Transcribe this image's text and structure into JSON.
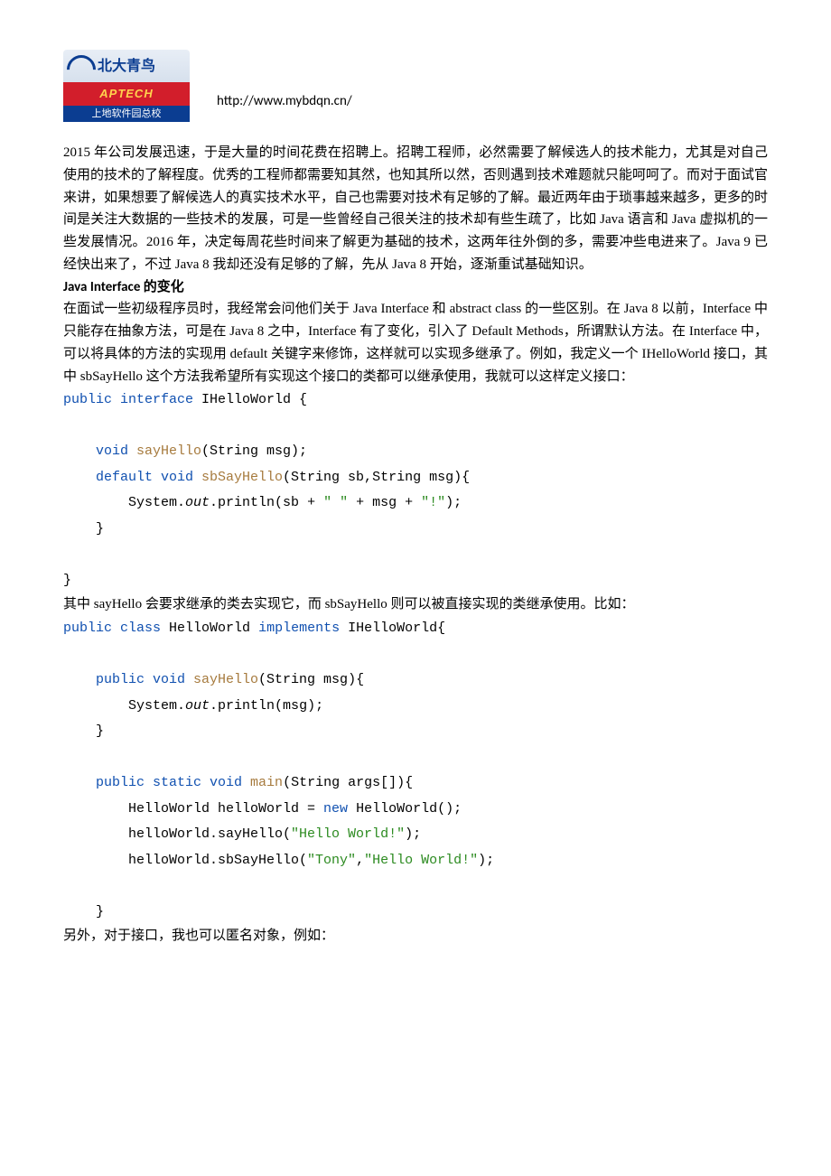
{
  "logo": {
    "brand_cn": "北大青鸟",
    "brand_en": "APTECH",
    "subtitle": "上地软件园总校"
  },
  "header_url": "http://www.mybdqn.cn/",
  "para1": "2015 年公司发展迅速，于是大量的时间花费在招聘上。招聘工程师，必然需要了解候选人的技术能力，尤其是对自己使用的技术的了解程度。优秀的工程师都需要知其然，也知其所以然，否则遇到技术难题就只能呵呵了。而对于面试官来讲，如果想要了解候选人的真实技术水平，自己也需要对技术有足够的了解。最近两年由于琐事越来越多，更多的时间是关注大数据的一些技术的发展，可是一些曾经自己很关注的技术却有些生疏了，比如 Java 语言和 Java 虚拟机的一些发展情况。2016 年，决定每周花些时间来了解更为基础的技术，这两年往外倒的多，需要冲些电进来了。Java 9 已经快出来了，不过 Java 8 我却还没有足够的了解，先从 Java 8 开始，逐渐重试基础知识。",
  "heading1": "Java Interface 的变化",
  "para2": "在面试一些初级程序员时，我经常会问他们关于 Java Interface 和 abstract class 的一些区别。在 Java 8 以前，Interface 中只能存在抽象方法，可是在 Java 8 之中，Interface 有了变化，引入了 Default Methods，所谓默认方法。在 Interface 中，可以将具体的方法的实现用 default 关键字来修饰，这样就可以实现多继承了。例如，我定义一个 IHelloWorld 接口，其中 sbSayHello 这个方法我希望所有实现这个接口的类都可以继承使用，我就可以这样定义接口：",
  "code1": {
    "l1a": "public interface ",
    "l1b": "IHelloWorld {",
    "l2a": "    void ",
    "l2b": "sayHello",
    "l2c": "(String msg);",
    "l3a": "    default void ",
    "l3b": "sbSayHello",
    "l3c": "(String sb,String msg){",
    "l4a": "        System.",
    "l4b": "out",
    "l4c": ".println(sb + ",
    "l4d": "\" \"",
    "l4e": " + msg + ",
    "l4f": "\"!\"",
    "l4g": ");",
    "l5": "    }",
    "l6": "}"
  },
  "para3": "其中 sayHello 会要求继承的类去实现它，而 sbSayHello 则可以被直接实现的类继承使用。比如：",
  "code2": {
    "l1a": "public class ",
    "l1b": "HelloWorld ",
    "l1c": "implements ",
    "l1d": "IHelloWorld{",
    "l2a": "    public void ",
    "l2b": "sayHello",
    "l2c": "(String msg){",
    "l3a": "        System.",
    "l3b": "out",
    "l3c": ".println(msg);",
    "l4": "    }",
    "l5a": "    public static void ",
    "l5b": "main",
    "l5c": "(String args[]){",
    "l6a": "        HelloWorld helloWorld = ",
    "l6b": "new ",
    "l6c": "HelloWorld();",
    "l7a": "        helloWorld.sayHello(",
    "l7b": "\"Hello World!\"",
    "l7c": ");",
    "l8a": "        helloWorld.sbSayHello(",
    "l8b": "\"Tony\"",
    "l8c": ",",
    "l8d": "\"Hello World!\"",
    "l8e": ");",
    "l9": "    }"
  },
  "para4": "另外，对于接口，我也可以匿名对象，例如："
}
